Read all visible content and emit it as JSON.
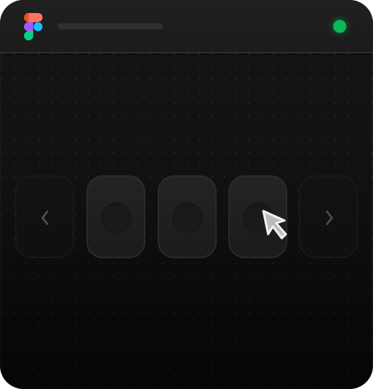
{
  "app": {
    "logo_icon": "figma-icon",
    "title": "",
    "status_color": "#09b85b",
    "status": "online"
  },
  "carousel": {
    "previous_icon": "chevron-left-icon",
    "next_icon": "chevron-right-icon",
    "slots": [
      {
        "state": "default"
      },
      {
        "state": "default"
      },
      {
        "state": "hovered"
      }
    ]
  },
  "cursor": {
    "icon": "cursor-arrow-icon"
  }
}
